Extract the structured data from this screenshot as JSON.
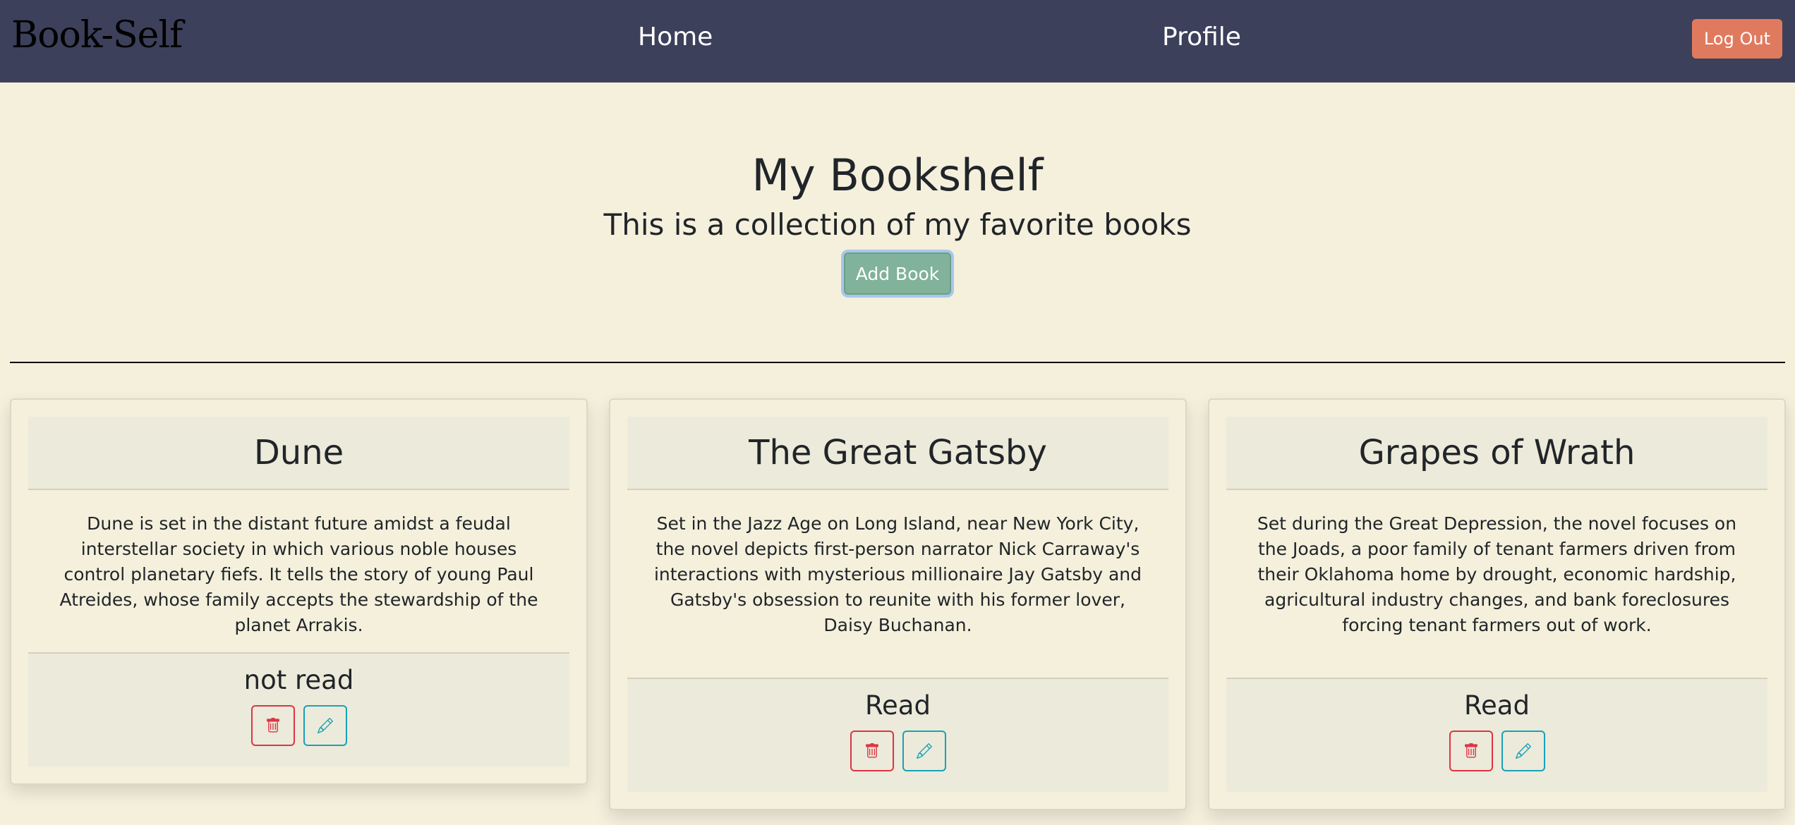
{
  "navbar": {
    "brand": "Book-Self",
    "links": [
      "Home",
      "Profile"
    ],
    "logout_label": "Log Out"
  },
  "hero": {
    "title": "My Bookshelf",
    "subtitle": "This is a collection of my favorite books",
    "add_label": "Add Book"
  },
  "books": [
    {
      "title": "Dune",
      "description": "Dune is set in the distant future amidst a feudal interstellar society in which various noble houses control planetary fiefs. It tells the story of young Paul Atreides, whose family accepts the stewardship of the planet Arrakis.",
      "status": "not read"
    },
    {
      "title": "The Great Gatsby",
      "description": "Set in the Jazz Age on Long Island, near New York City, the novel depicts first-person narrator Nick Carraway's interactions with mysterious millionaire Jay Gatsby and Gatsby's obsession to reunite with his former lover, Daisy Buchanan.",
      "status": "Read"
    },
    {
      "title": "Grapes of Wrath",
      "description": "Set during the Great Depression, the novel focuses on the Joads, a poor family of tenant farmers driven from their Oklahoma home by drought, economic hardship, agricultural industry changes, and bank foreclosures forcing tenant farmers out of work.",
      "status": "Read"
    }
  ],
  "icons": {
    "delete": "trash-icon",
    "edit": "pencil-icon"
  },
  "colors": {
    "navbar": "#3d405b",
    "background": "#f4f0dc",
    "logout": "#e07a5f",
    "add_book": "#81b29a",
    "delete": "#dc3545",
    "edit": "#17a2b8"
  }
}
